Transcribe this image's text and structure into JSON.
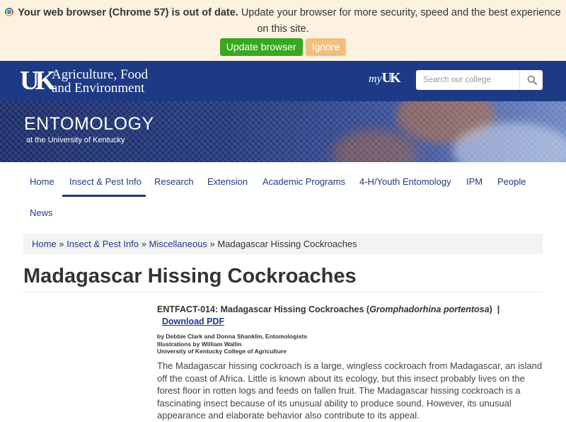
{
  "browser_banner": {
    "bold_text": "Your web browser (Chrome 57) is out of date.",
    "text": "Update your browser for more security, speed and the best experience on this site.",
    "update_label": "Update browser",
    "ignore_label": "Ignore"
  },
  "header": {
    "logo": "UK",
    "college_line1": "Agriculture, Food",
    "college_line2": "and Environment",
    "myuk_prefix": "my",
    "myuk_suffix": "UK",
    "search_placeholder": "Search our college"
  },
  "hero": {
    "title": "ENTOMOLOGY",
    "subtitle": "at the University of Kentucky"
  },
  "nav": {
    "items": [
      {
        "label": "Home"
      },
      {
        "label": "Insect & Pest Info"
      },
      {
        "label": "Research"
      },
      {
        "label": "Extension"
      },
      {
        "label": "Academic Programs"
      },
      {
        "label": "4-H/Youth Entomology"
      },
      {
        "label": "IPM"
      },
      {
        "label": "People"
      },
      {
        "label": "News"
      }
    ],
    "active_label": "Insect & Pest Info"
  },
  "breadcrumb": {
    "items": [
      {
        "label": "Home"
      },
      {
        "label": "Insect & Pest Info"
      },
      {
        "label": "Miscellaneous"
      }
    ],
    "separator": "»",
    "current": "Madagascar Hissing Cockroaches"
  },
  "page": {
    "title": "Madagascar Hissing Cockroaches",
    "entfact_prefix": "ENTFACT-014: Madagascar Hissing Cockroaches (",
    "entfact_species": "Gromphadorhina portentosa",
    "entfact_suffix": ")",
    "pipe": "|",
    "download_label": "Download PDF",
    "byline1": "by Debbie Clark and Donna Shanklin, Entomologists",
    "byline2": "Illustrations by William Wallin",
    "byline3": "University of Kentucky College of Agriculture",
    "paragraph": "The Madagascar hissing cockroach is a large, wingless cockroach from Madagascar, an island off the coast of Africa. Little is known about its ecology, but this insect probably lives on the forest floor in rotten logs and feeds on fallen fruit. The Madagascar hissing cockroach is a fascinating insect because of its unusual ability to produce sound. However, its unusual appearance and elaborate behavior also contribute to its appeal."
  },
  "colors": {
    "brand_blue": "#1e3a84",
    "banner_bg": "#fdf2e0",
    "update_green": "#38a820",
    "ignore_orange": "#f0c080"
  }
}
